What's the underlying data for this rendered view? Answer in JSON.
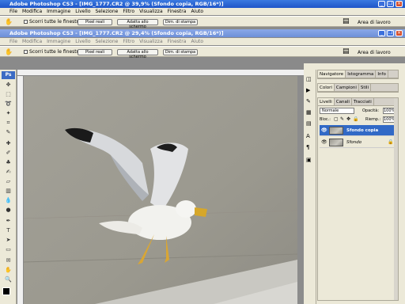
{
  "window1": {
    "title": "Adobe Photoshop CS3 - [IMG_1777.CR2 @ 39,9% (Sfondo copia, RGB/16*)]",
    "menu": [
      "File",
      "Modifica",
      "Immagine",
      "Livello",
      "Selezione",
      "Filtro",
      "Visualizza",
      "Finestra",
      "Aiuto"
    ]
  },
  "window2": {
    "title": "Adobe Photoshop CS3 - [IMG_1777.CR2 @ 29,4% (Sfondo copia, RGB/16*)]",
    "menu": [
      "File",
      "Modifica",
      "Immagine",
      "Livello",
      "Selezione",
      "Filtro",
      "Visualizza",
      "Finestra",
      "Aiuto"
    ]
  },
  "options": {
    "checkbox_label": "Scorri tutte le finestre",
    "btn_pixel": "Pixel reali",
    "btn_fit": "Adatta allo schermo",
    "btn_print": "Dim. di stampa",
    "workspace": "Area di lavoro"
  },
  "navigator_tabs": [
    "Navigatore",
    "Istogramma",
    "Info"
  ],
  "color_tabs": [
    "Colori",
    "Campioni",
    "Stili"
  ],
  "layers_tabs": [
    "Livelli",
    "Canali",
    "Tracciati"
  ],
  "layers": {
    "blend_mode": "Normale",
    "opacity_label": "Opacità:",
    "opacity_value": "100%",
    "lock_label": "Bloc.:",
    "fill_label": "Riemp.:",
    "fill_value": "100%",
    "items": [
      {
        "name": "Sfondo copia",
        "selected": true
      },
      {
        "name": "Sfondo",
        "selected": false
      }
    ]
  },
  "colors": {
    "title_active": "#2458c8",
    "selection": "#3169c6",
    "panel_bg": "#ece9d8"
  }
}
